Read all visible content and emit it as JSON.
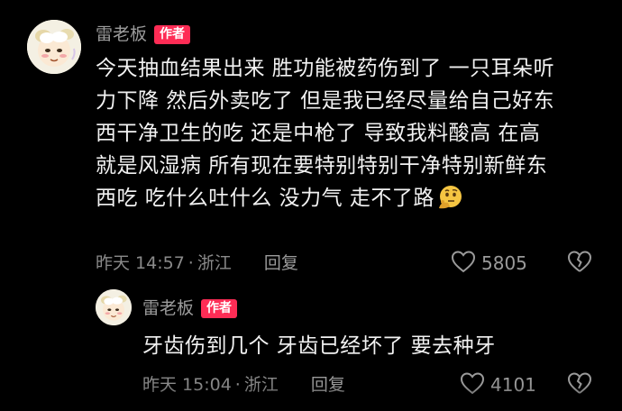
{
  "comments": [
    {
      "username": "雷老板",
      "badge": "作者",
      "lines": [
        "今天抽血结果出来 胜功能被药伤到了 一只耳朵听",
        "力下降 然后外卖吃了 但是我已经尽量给自己好东",
        "西干净卫生的吃 还是中枪了 导致我料酸高 在高",
        "就是风湿病 所有现在要特别特别干净特别新鲜东",
        "西吃 吃什么吐什么 没力气 走不了路"
      ],
      "emoji": "thinking-face-icon",
      "time": "昨天 14:57",
      "separator": "·",
      "location": "浙江",
      "reply_label": "回复",
      "likes": "5805"
    },
    {
      "username": "雷老板",
      "badge": "作者",
      "text": "牙齿伤到几个 牙齿已经坏了 要去种牙",
      "time": "昨天 15:04",
      "separator": "·",
      "location": "浙江",
      "reply_label": "回复",
      "likes": "4101"
    }
  ],
  "colors": {
    "background": "#000000",
    "badge": "#fe2c55",
    "username": "#9b9b9b",
    "meta": "#8a8a8a"
  }
}
